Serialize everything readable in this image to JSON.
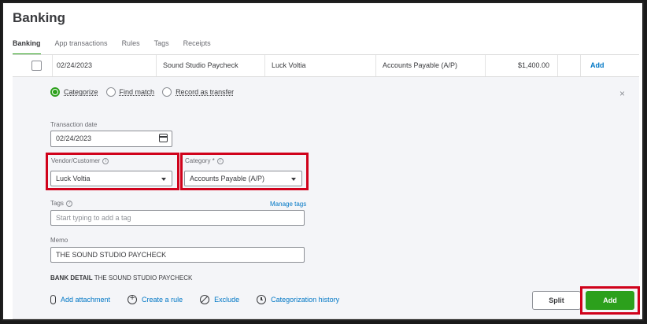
{
  "page": {
    "title": "Banking"
  },
  "tabs": [
    {
      "label": "Banking",
      "active": true
    },
    {
      "label": "App transactions",
      "active": false
    },
    {
      "label": "Rules",
      "active": false
    },
    {
      "label": "Tags",
      "active": false
    },
    {
      "label": "Receipts",
      "active": false
    }
  ],
  "transaction": {
    "date": "02/24/2023",
    "description": "Sound Studio Paycheck",
    "payee": "Luck Voltia",
    "category": "Accounts Payable (A/P)",
    "amount": "$1,400.00",
    "action_label": "Add"
  },
  "mode_options": {
    "categorize": "Categorize",
    "find_match": "Find match",
    "record_transfer": "Record as transfer",
    "selected": "Categorize"
  },
  "close_icon": "×",
  "form": {
    "transaction_date": {
      "label": "Transaction date",
      "value": "02/24/2023"
    },
    "vendor_customer": {
      "label": "Vendor/Customer",
      "value": "Luck Voltia"
    },
    "category": {
      "label": "Category *",
      "value": "Accounts Payable (A/P)"
    },
    "tags": {
      "label": "Tags",
      "placeholder": "Start typing to add a tag",
      "manage_label": "Manage tags"
    },
    "memo": {
      "label": "Memo",
      "value": "THE SOUND STUDIO PAYCHECK"
    }
  },
  "bank_detail": {
    "label": "BANK DETAIL",
    "value": "THE SOUND STUDIO PAYCHECK"
  },
  "actions": {
    "add_attachment": "Add attachment",
    "create_rule": "Create a rule",
    "exclude": "Exclude",
    "categorization_history": "Categorization history"
  },
  "buttons": {
    "split": "Split",
    "add": "Add"
  },
  "colors": {
    "accent_green": "#2ca01c",
    "link_blue": "#0077c5",
    "highlight_red": "#d0021b"
  },
  "icons": [
    "calendar-icon",
    "chevron-down-icon",
    "info-icon",
    "paperclip-icon",
    "plus-circle-icon",
    "ban-icon",
    "history-icon",
    "close-icon"
  ]
}
